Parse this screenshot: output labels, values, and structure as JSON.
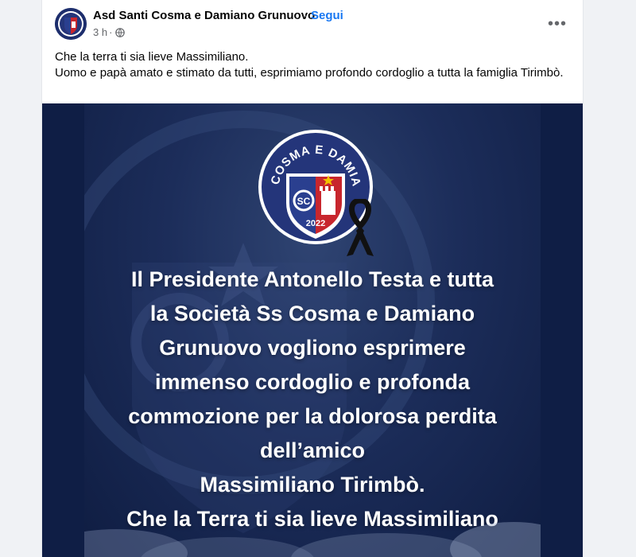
{
  "post": {
    "author": "Asd Santi Cosma e Damiano Grunuovo",
    "separator": "·",
    "follow_label": "Segui",
    "time": "3 h",
    "time_sep": "·",
    "privacy_icon": "globe-icon",
    "more_icon": "more-options-icon",
    "more_label": "•••",
    "caption": {
      "line1": "Che la terra ti sia lieve Massimiliano.",
      "line2": "Uomo e papà amato e stimato da tutti, esprimiamo profondo cordoglio a tutta la famiglia Tirimbò."
    }
  },
  "image": {
    "logo": {
      "arc_text": "SS COSMA E DAMIANO",
      "year": "2022",
      "monogram": "SC"
    },
    "message_lines": [
      "Il Presidente Antonello Testa e tutta",
      "la Società Ss Cosma e Damiano",
      "Grunuovo vogliono esprimere",
      "immenso cordoglio e profonda",
      "commozione per la dolorosa perdita",
      "dell’amico",
      "Massimiliano Tirimbò.",
      "Che la Terra ti sia lieve Massimiliano"
    ]
  },
  "colors": {
    "link": "#1877f2",
    "poster_bg": "#1c2d5a",
    "logo_red": "#c8262d",
    "logo_blue": "#2a3f8f"
  }
}
